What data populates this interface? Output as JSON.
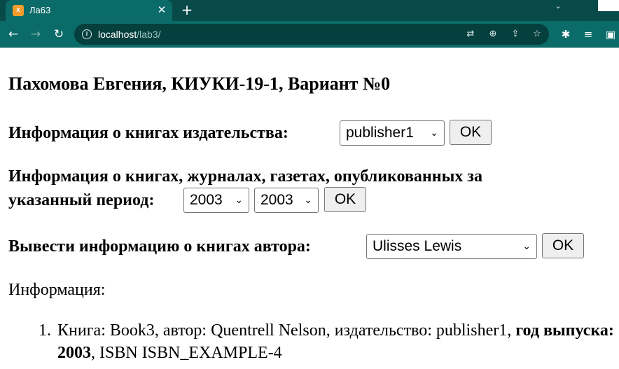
{
  "browser": {
    "tab_title": "Ла63",
    "tab_favicon": "XAMPP-icon",
    "url_host": "localhost",
    "url_path": "/lab3/",
    "icons": [
      "back-icon",
      "forward-icon",
      "reload-icon",
      "info-icon",
      "translate-icon",
      "zoom-icon",
      "share-icon",
      "star-icon",
      "extensions-icon",
      "media-icon",
      "sidepanel-icon",
      "tab-search-icon",
      "close-icon",
      "new-tab-icon"
    ],
    "colors": {
      "tabstrip": "#084a48",
      "toolbar": "#0b6b68",
      "omnibox": "#06403e"
    }
  },
  "page": {
    "title": "Пахомова Евгения, КИУКИ-19-1, Вариант №0",
    "publisher_form": {
      "label": "Информация о книгах издательства:",
      "selected": "publisher1",
      "button": "OK"
    },
    "period_form": {
      "label_line1": "Информация о книгах, журналах, газетах, опубликованных за",
      "label_line2": "указанный период:",
      "from_selected": "2003",
      "to_selected": "2003",
      "button": "OK"
    },
    "author_form": {
      "label": "Вывести информацию о книгах автора:",
      "selected": "Ulisses Lewis",
      "button": "OK"
    },
    "info_heading": "Информация:",
    "results": [
      {
        "number": "1.",
        "part1": "Книга: Book3, автор: Quentrell Nelson, издательство: publisher1, ",
        "bold_label": "год выпуска: 2003",
        "part2": ", ISBN ISBN_EXAMPLE-4"
      }
    ]
  }
}
